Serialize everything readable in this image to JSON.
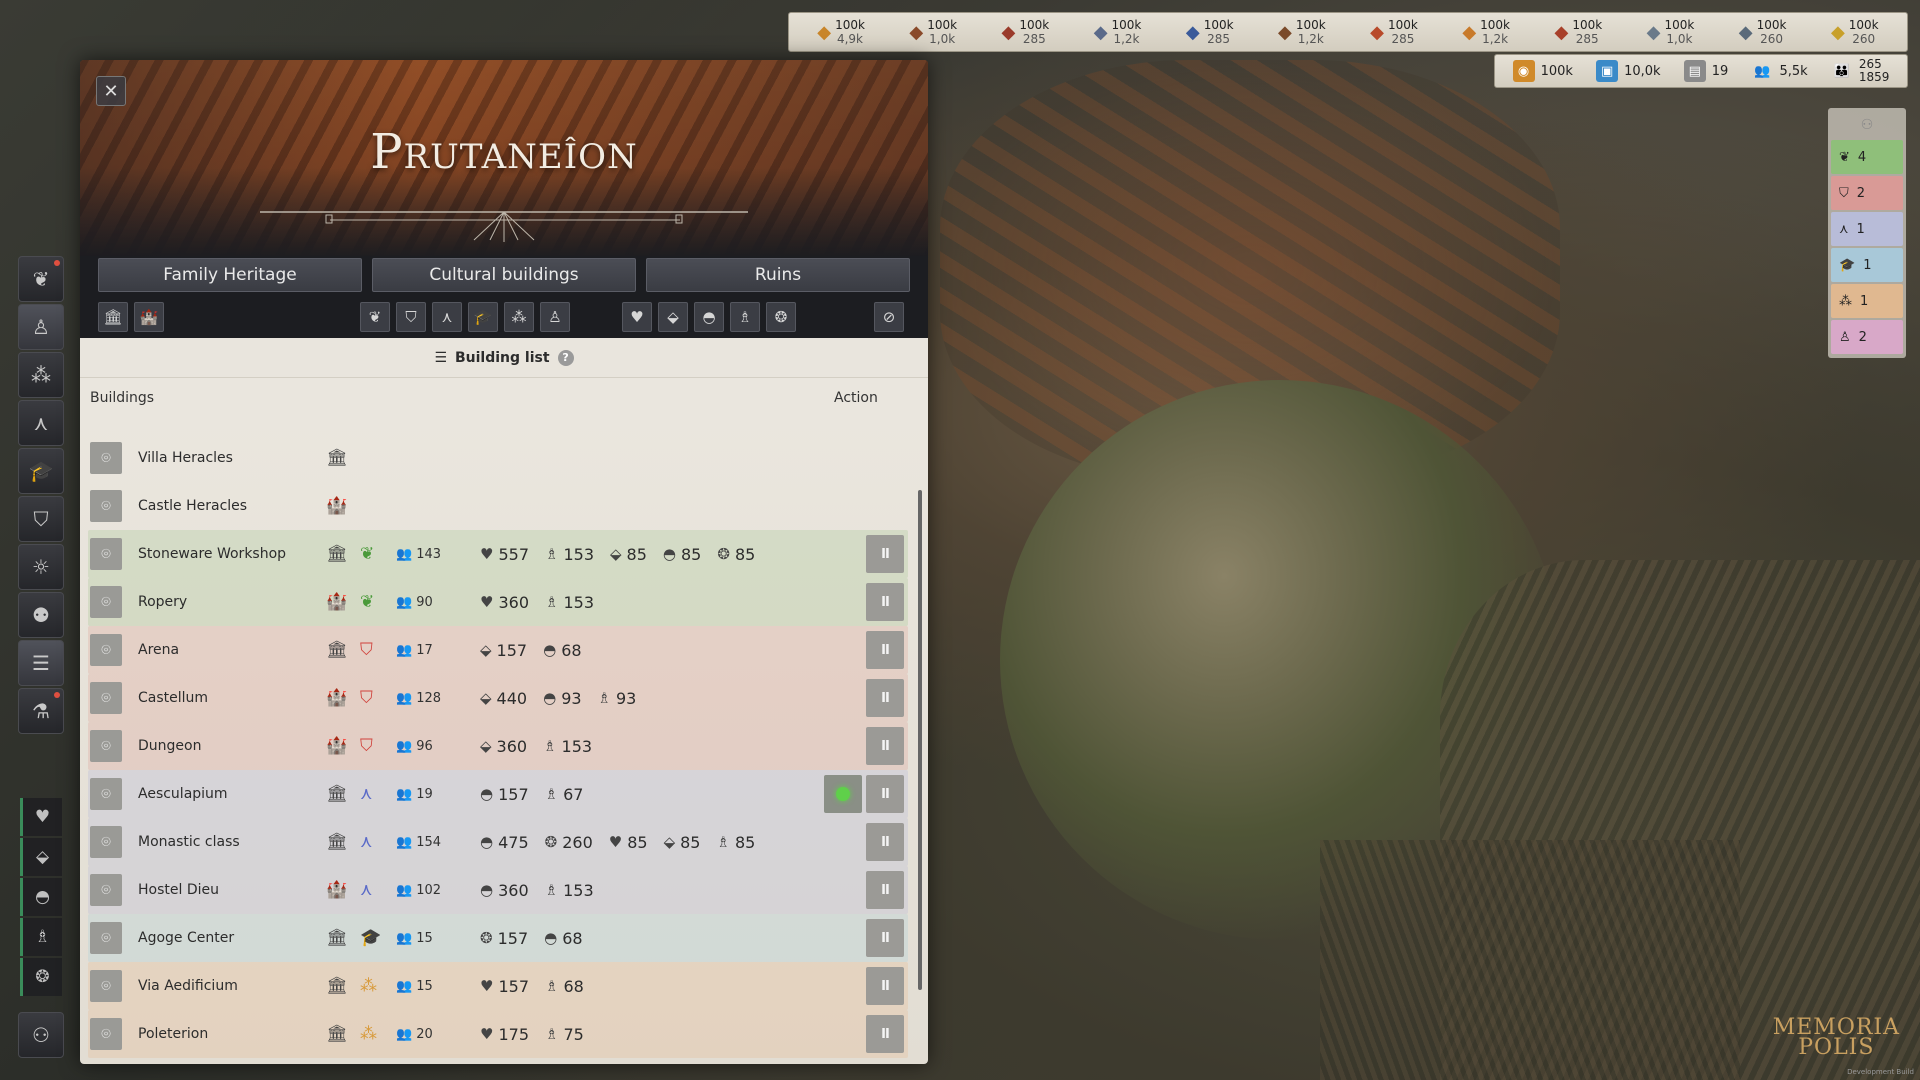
{
  "resources": [
    {
      "icon": "bread-icon",
      "value": "100k",
      "sub": "4,9k",
      "color": "#c8852a"
    },
    {
      "icon": "meat-icon",
      "value": "100k",
      "sub": "1,0k",
      "color": "#8a4a2a"
    },
    {
      "icon": "sausage-icon",
      "value": "100k",
      "sub": "285",
      "color": "#9a3a2a"
    },
    {
      "icon": "amphora-icon",
      "value": "100k",
      "sub": "1,2k",
      "color": "#5a6a8a"
    },
    {
      "icon": "fish-icon",
      "value": "100k",
      "sub": "285",
      "color": "#3a5a9a"
    },
    {
      "icon": "wood-icon",
      "value": "100k",
      "sub": "1,2k",
      "color": "#7a4a2a"
    },
    {
      "icon": "brick-icon",
      "value": "100k",
      "sub": "285",
      "color": "#b84a2a"
    },
    {
      "icon": "tent-icon",
      "value": "100k",
      "sub": "1,2k",
      "color": "#c87a2a"
    },
    {
      "icon": "torch-icon",
      "value": "100k",
      "sub": "285",
      "color": "#a8402a"
    },
    {
      "icon": "cloth-icon",
      "value": "100k",
      "sub": "1,0k",
      "color": "#6a7a8a"
    },
    {
      "icon": "tool-icon",
      "value": "100k",
      "sub": "260",
      "color": "#5a6a7a"
    },
    {
      "icon": "gold-icon",
      "value": "100k",
      "sub": "260",
      "color": "#c8a02a"
    }
  ],
  "resources2": {
    "coins": {
      "icon": "coin-icon",
      "value": "100k"
    },
    "knowledge": {
      "icon": "book-icon",
      "value": "10,0k"
    },
    "scroll": {
      "icon": "scroll-icon",
      "value": "19"
    },
    "citizens": {
      "icon": "people-icon",
      "value": "5,5k"
    },
    "population": {
      "icon": "population-icon",
      "value": "265",
      "sub": "1859"
    }
  },
  "right_counters": [
    {
      "icon": "laurel-icon",
      "value": "4",
      "bg": "#8fbf7a"
    },
    {
      "icon": "arena-icon",
      "value": "2",
      "bg": "#d99a96"
    },
    {
      "icon": "aesculap-icon",
      "value": "1",
      "bg": "#b8bcd8"
    },
    {
      "icon": "graduation-icon",
      "value": "1",
      "bg": "#a8c8d8"
    },
    {
      "icon": "dots-icon",
      "value": "1",
      "bg": "#e0b890"
    },
    {
      "icon": "statue-icon",
      "value": "2",
      "bg": "#d8a8c8"
    }
  ],
  "logo": {
    "line1": "MEMORIA",
    "line2": "POLIS"
  },
  "dev": "Development Build",
  "panel": {
    "title": "Prutaneîon",
    "close": "✕",
    "tabs": [
      "Family Heritage",
      "Cultural buildings",
      "Ruins"
    ],
    "list_header": "Building list",
    "help": "?",
    "col_buildings": "Buildings",
    "col_action": "Action"
  },
  "buildings": [
    {
      "name": "Villa Heracles",
      "type": "🏛",
      "cat": "",
      "cat_color": "#444",
      "workers": "",
      "effects": [],
      "bg": "transparent",
      "pause": false
    },
    {
      "name": "Castle Heracles",
      "type": "🏰",
      "cat": "",
      "cat_color": "#444",
      "workers": "",
      "effects": [],
      "bg": "transparent",
      "pause": false
    },
    {
      "name": "Stoneware Workshop",
      "type": "🏛",
      "cat": "❦",
      "cat_color": "#4a9a3a",
      "workers": "143",
      "effects": [
        {
          "i": "♥",
          "v": "557"
        },
        {
          "i": "♗",
          "v": "153"
        },
        {
          "i": "⬙",
          "v": "85"
        },
        {
          "i": "◓",
          "v": "85"
        },
        {
          "i": "❂",
          "v": "85"
        }
      ],
      "bg": "rgba(150,190,130,0.25)",
      "pause": true
    },
    {
      "name": "Ropery",
      "type": "🏰",
      "cat": "❦",
      "cat_color": "#4a9a3a",
      "workers": "90",
      "effects": [
        {
          "i": "♥",
          "v": "360"
        },
        {
          "i": "♗",
          "v": "153"
        }
      ],
      "bg": "rgba(150,190,130,0.25)",
      "pause": true
    },
    {
      "name": "Arena",
      "type": "🏛",
      "cat": "⛉",
      "cat_color": "#d0403a",
      "workers": "17",
      "effects": [
        {
          "i": "⬙",
          "v": "157"
        },
        {
          "i": "◓",
          "v": "68"
        }
      ],
      "bg": "rgba(220,150,140,0.25)",
      "pause": true
    },
    {
      "name": "Castellum",
      "type": "🏰",
      "cat": "⛉",
      "cat_color": "#d0403a",
      "workers": "128",
      "effects": [
        {
          "i": "⬙",
          "v": "440"
        },
        {
          "i": "◓",
          "v": "93"
        },
        {
          "i": "♗",
          "v": "93"
        }
      ],
      "bg": "rgba(220,150,140,0.25)",
      "pause": true
    },
    {
      "name": "Dungeon",
      "type": "🏰",
      "cat": "⛉",
      "cat_color": "#d0403a",
      "workers": "96",
      "effects": [
        {
          "i": "⬙",
          "v": "360"
        },
        {
          "i": "♗",
          "v": "153"
        }
      ],
      "bg": "rgba(220,150,140,0.25)",
      "pause": true
    },
    {
      "name": "Aesculapium",
      "type": "🏛",
      "cat": "⋏",
      "cat_color": "#5a6ac8",
      "workers": "19",
      "effects": [
        {
          "i": "◓",
          "v": "157"
        },
        {
          "i": "♗",
          "v": "67"
        }
      ],
      "bg": "rgba(170,175,215,0.25)",
      "pause": true,
      "go": true
    },
    {
      "name": "Monastic class",
      "type": "🏛",
      "cat": "⋏",
      "cat_color": "#5a6ac8",
      "workers": "154",
      "effects": [
        {
          "i": "◓",
          "v": "475"
        },
        {
          "i": "❂",
          "v": "260"
        },
        {
          "i": "♥",
          "v": "85"
        },
        {
          "i": "⬙",
          "v": "85"
        },
        {
          "i": "♗",
          "v": "85"
        }
      ],
      "bg": "rgba(170,175,215,0.25)",
      "pause": true
    },
    {
      "name": "Hostel Dieu",
      "type": "🏰",
      "cat": "⋏",
      "cat_color": "#5a6ac8",
      "workers": "102",
      "effects": [
        {
          "i": "◓",
          "v": "360"
        },
        {
          "i": "♗",
          "v": "153"
        }
      ],
      "bg": "rgba(170,175,215,0.25)",
      "pause": true
    },
    {
      "name": "Agoge Center",
      "type": "🏛",
      "cat": "🎓",
      "cat_color": "#2a8ab8",
      "workers": "15",
      "effects": [
        {
          "i": "❂",
          "v": "157"
        },
        {
          "i": "◓",
          "v": "68"
        }
      ],
      "bg": "rgba(150,200,220,0.22)",
      "pause": true
    },
    {
      "name": "Via Aedificium",
      "type": "🏛",
      "cat": "⁂",
      "cat_color": "#d89a3a",
      "workers": "15",
      "effects": [
        {
          "i": "♥",
          "v": "157"
        },
        {
          "i": "♗",
          "v": "68"
        }
      ],
      "bg": "rgba(230,180,130,0.25)",
      "pause": true
    },
    {
      "name": "Poleterion",
      "type": "🏛",
      "cat": "⁂",
      "cat_color": "#d89a3a",
      "workers": "20",
      "effects": [
        {
          "i": "♥",
          "v": "175"
        },
        {
          "i": "♗",
          "v": "75"
        }
      ],
      "bg": "rgba(230,180,130,0.25)",
      "pause": true
    }
  ],
  "pause_label": "II",
  "worker_icon": "👥",
  "left_menu": [
    {
      "icon": "❦",
      "name": "laurel-menu-icon",
      "dot": true
    },
    {
      "icon": "♙",
      "name": "statue-menu-icon",
      "dot": false,
      "active": true
    },
    {
      "icon": "⁂",
      "name": "crafts-menu-icon",
      "dot": false
    },
    {
      "icon": "⋏",
      "name": "medicine-menu-icon",
      "dot": false
    },
    {
      "icon": "🎓",
      "name": "education-menu-icon",
      "dot": false
    },
    {
      "icon": "⛉",
      "name": "arena-menu-icon",
      "dot": false
    },
    {
      "icon": "☼",
      "name": "sun-menu-icon",
      "dot": false
    },
    {
      "icon": "⚉",
      "name": "group-menu-icon",
      "dot": false
    },
    {
      "icon": "☰",
      "name": "list-menu-icon",
      "dot": false,
      "active": true
    },
    {
      "icon": "⚗",
      "name": "flask-menu-icon",
      "dot": true
    }
  ],
  "left_small": [
    {
      "icon": "♥",
      "name": "heart-filter-icon"
    },
    {
      "icon": "⬙",
      "name": "shield-filter-icon"
    },
    {
      "icon": "◓",
      "name": "swirl-filter-icon"
    },
    {
      "icon": "♗",
      "name": "figure-filter-icon"
    },
    {
      "icon": "❂",
      "name": "gear-filter-icon"
    }
  ],
  "left_bottom": {
    "icon": "⚇",
    "name": "mask-menu-icon"
  }
}
